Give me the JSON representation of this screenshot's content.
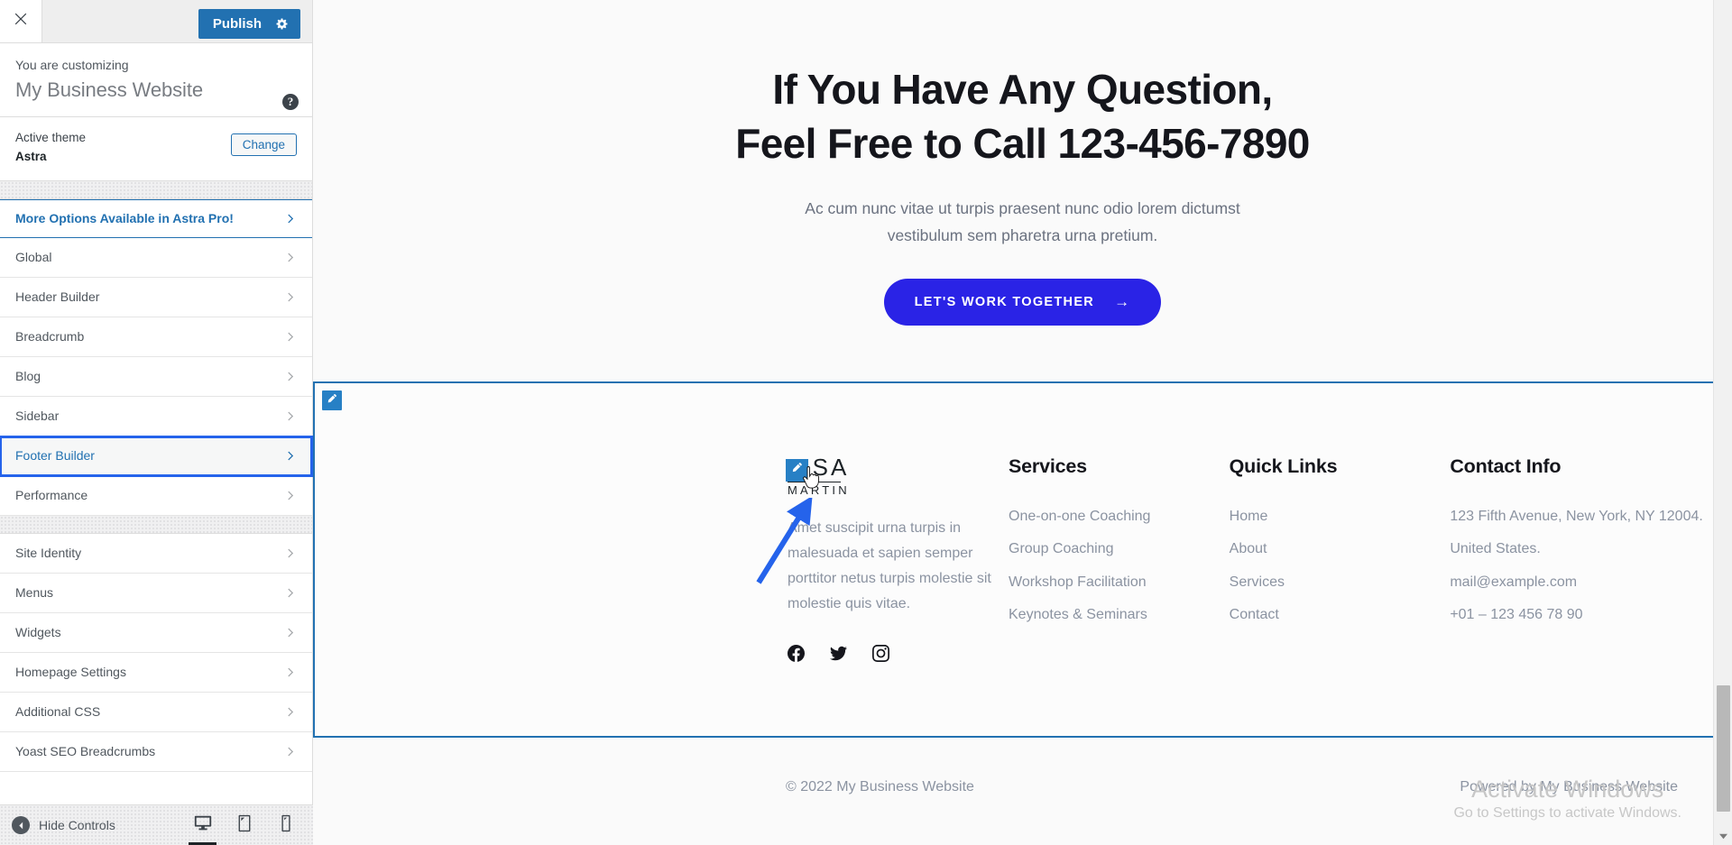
{
  "customizer": {
    "close_label": "Close customizer",
    "publish_label": "Publish",
    "settings_icon": "gear-icon",
    "info_label": "You are customizing",
    "site_title": "My Business Website",
    "help_label": "?",
    "theme_label": "Active theme",
    "theme_name": "Astra",
    "change_button": "Change",
    "panels": [
      {
        "label": "More Options Available in Astra Pro!",
        "style": "pro"
      },
      {
        "label": "Global",
        "style": "normal"
      },
      {
        "label": "Header Builder",
        "style": "normal"
      },
      {
        "label": "Breadcrumb",
        "style": "normal"
      },
      {
        "label": "Blog",
        "style": "normal"
      },
      {
        "label": "Sidebar",
        "style": "normal"
      },
      {
        "label": "Footer Builder",
        "style": "focused"
      },
      {
        "label": "Performance",
        "style": "normal"
      }
    ],
    "panels2": [
      {
        "label": "Site Identity",
        "style": "normal"
      },
      {
        "label": "Menus",
        "style": "normal"
      },
      {
        "label": "Widgets",
        "style": "normal"
      },
      {
        "label": "Homepage Settings",
        "style": "normal"
      },
      {
        "label": "Additional CSS",
        "style": "normal"
      },
      {
        "label": "Yoast SEO Breadcrumbs",
        "style": "normal"
      }
    ],
    "hide_controls_label": "Hide Controls",
    "devices": [
      {
        "name": "desktop",
        "active": true
      },
      {
        "name": "tablet",
        "active": false
      },
      {
        "name": "mobile",
        "active": false
      }
    ],
    "accent_color": "#2271b1"
  },
  "preview": {
    "hero": {
      "heading_line1": "If You Have Any Question,",
      "heading_line2": "Feel Free to Call 123-456-7890",
      "sub_line1": "Ac cum nunc vitae ut turpis praesent nunc odio lorem dictumst",
      "sub_line2": "vestibulum sem pharetra urna pretium.",
      "cta_label": "LET'S WORK TOGETHER",
      "cta_arrow": "→",
      "cta_color": "#2a23e6"
    },
    "footer": {
      "edit_badge_icon": "pencil-icon",
      "brand": {
        "logo_top": "LISA",
        "logo_bottom": "MARTIN",
        "description": "Amet suscipit urna turpis in malesuada et sapien semper porttitor netus turpis molestie sit molestie quis vitae.",
        "socials": [
          "facebook-icon",
          "twitter-icon",
          "instagram-icon"
        ]
      },
      "columns": [
        {
          "title": "Services",
          "items": [
            "One-on-one Coaching",
            "Group Coaching",
            "Workshop Facilitation",
            "Keynotes & Seminars"
          ]
        },
        {
          "title": "Quick Links",
          "items": [
            "Home",
            "About",
            "Services",
            "Contact"
          ]
        },
        {
          "title": "Contact Info",
          "items": [
            "123 Fifth Avenue, New York, NY 12004.",
            "United States.",
            "mail@example.com",
            "+01 – 123 456 78 90"
          ]
        }
      ],
      "copyright": "© 2022 My Business Website",
      "powered_by": "Powered by My Business Website"
    },
    "watermark": {
      "title": "Activate Windows",
      "subtitle": "Go to Settings to activate Windows."
    }
  }
}
